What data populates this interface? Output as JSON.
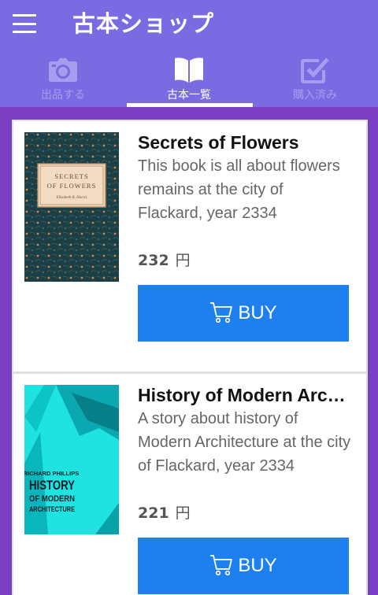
{
  "appbar": {
    "title": "古本ショップ",
    "menu_icon": "hamburger-menu-icon",
    "background": "#7b6be3"
  },
  "tabs": [
    {
      "label": "出品する",
      "icon": "camera-icon",
      "active": false
    },
    {
      "label": "古本一覧",
      "icon": "book-open-icon",
      "active": true
    },
    {
      "label": "購入済み",
      "icon": "checkbox-icon",
      "active": false
    }
  ],
  "books": [
    {
      "title": "Secrets of Flowers",
      "description": "This book is all about flowers remains at the city of Flackard, year 2334",
      "price": "232",
      "currency": "円",
      "buy_label": "BUY",
      "cover": {
        "title_line1": "SECRETS",
        "title_line2": "OF FLOWERS",
        "author": "Elizabeth R. Harris"
      }
    },
    {
      "title": "History of Modern Architecture",
      "description": "A story about history of Modern Architecture at the city of Flackard, year 2334",
      "price": "221",
      "currency": "円",
      "buy_label": "BUY",
      "cover": {
        "author": "RICHARD PHILLIPS",
        "title_line1": "HISTORY",
        "title_line2": "OF MODERN",
        "title_line3": "ARCHITECTURE"
      }
    }
  ],
  "colors": {
    "accent": "#1e80ee",
    "page_background": "#7b3fc4",
    "tab_inactive": "#a79cee"
  }
}
